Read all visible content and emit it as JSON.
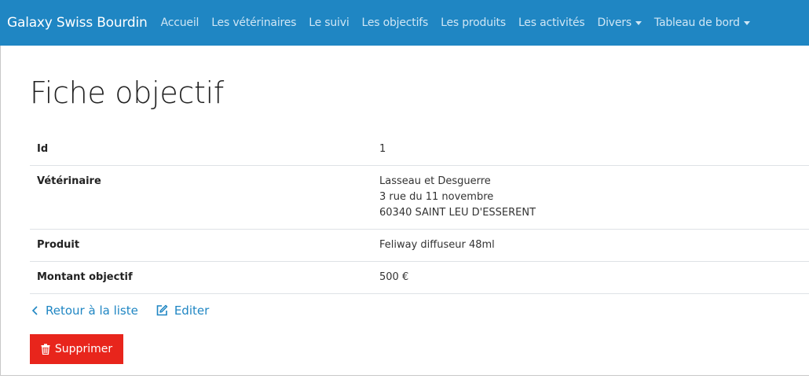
{
  "navbar": {
    "brand": "Galaxy Swiss Bourdin",
    "items": [
      {
        "label": "Accueil"
      },
      {
        "label": "Les vétérinaires"
      },
      {
        "label": "Le suivi"
      },
      {
        "label": "Les objectifs"
      },
      {
        "label": "Les produits"
      },
      {
        "label": "Les activités"
      },
      {
        "label": "Divers"
      },
      {
        "label": "Tableau de bord"
      }
    ]
  },
  "page": {
    "title": "Fiche objectif"
  },
  "details": {
    "id_label": "Id",
    "id_value": "1",
    "veterinaire_label": "Vétérinaire",
    "veterinaire_line1": "Lasseau et Desguerre",
    "veterinaire_line2": "3 rue du 11 novembre",
    "veterinaire_line3": "60340 SAINT LEU D'ESSERENT",
    "produit_label": "Produit",
    "produit_value": "Feliway diffuseur 48ml",
    "montant_label": "Montant objectif",
    "montant_value": "500 €"
  },
  "actions": {
    "back_label": "Retour à la liste",
    "edit_label": "Editer",
    "delete_label": "Supprimer"
  },
  "colors": {
    "navbar_bg": "#1f86c3",
    "link": "#1f86c3",
    "danger": "#e8251c"
  },
  "icons": {
    "back": "chevron-left-icon",
    "edit": "edit-icon",
    "delete": "trash-icon",
    "dropdown": "caret-down-icon"
  }
}
